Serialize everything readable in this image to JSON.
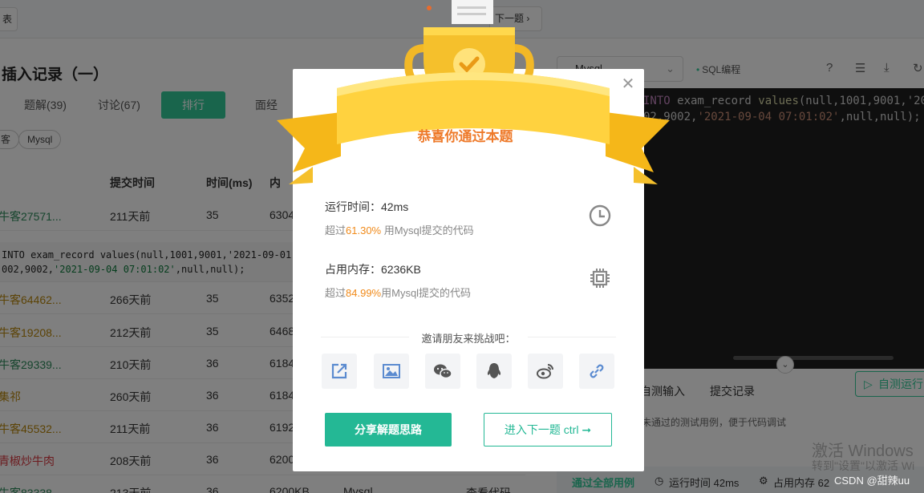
{
  "topbar": {
    "left_btn": "表",
    "next_btn": "下一题 ›"
  },
  "problem": {
    "title": "插入记录（一）"
  },
  "tabs": [
    {
      "label": "题解(39)"
    },
    {
      "label": "讨论(67)"
    },
    {
      "label": "排行"
    },
    {
      "label": "面经"
    }
  ],
  "chips": [
    "客",
    "Mysql"
  ],
  "table": {
    "headers": [
      "提交时间",
      "时间(ms)",
      "内"
    ],
    "rows": [
      {
        "user": "牛客27571...",
        "time": "211天前",
        "ms": "35",
        "mem": "6304"
      },
      {
        "user": "牛客64462...",
        "time": "266天前",
        "ms": "35",
        "mem": "6352"
      },
      {
        "user": "牛客19208...",
        "time": "212天前",
        "ms": "35",
        "mem": "6468"
      },
      {
        "user": "牛客29339...",
        "time": "210天前",
        "ms": "36",
        "mem": "6184"
      },
      {
        "user": "集祁",
        "time": "260天前",
        "ms": "36",
        "mem": "6184"
      },
      {
        "user": "牛客45532...",
        "time": "211天前",
        "ms": "36",
        "mem": "6192"
      },
      {
        "user": "青椒炒牛肉",
        "time": "208天前",
        "ms": "36",
        "mem": "6200"
      },
      {
        "user": "牛客83338",
        "time": "213天前",
        "ms": "36",
        "mem": "6200KB",
        "lang": "Mysql",
        "action": "查看代码"
      }
    ],
    "code_line1": "INTO exam_record values(null,1001,9001,'2021-09-01",
    "code_line2a": "002,9002,",
    "code_line2b": "'2021-09-04 07:01:02'",
    "code_line2c": ",null,null);"
  },
  "right": {
    "lang": "Mysql",
    "tag": "SQL编程",
    "editor_line1_kw": "INTO",
    "editor_line1_rest": " exam_record ",
    "editor_line1_fn": "values",
    "editor_line1_args": "(null,1001,9001,'20",
    "editor_line2": "02,9002,",
    "editor_line2_str": "'2021-09-04 07:01:02'",
    "editor_line2_end": ",null,null);",
    "bottom_tab1": "自测输入",
    "bottom_tab2": "提交记录",
    "selftest": "自测运行",
    "hint": "未通过的测试用例，便于代码调试",
    "status_pass": "通过全部用例",
    "status_time": "运行时间 42ms",
    "status_mem": "占用内存 62"
  },
  "watermark": {
    "line1": "激活 Windows",
    "line2": "转到\"设置\"以激活 Wi",
    "csdn": "CSDN @甜辣uu"
  },
  "modal": {
    "banner": "恭喜你通过本题",
    "runtime_label": "运行时间：42ms",
    "runtime_sub_pre": "超过",
    "runtime_pct": "61.30%",
    "runtime_sub_post": " 用Mysql提交的代码",
    "memory_label": "占用内存：6236KB",
    "memory_sub_pre": "超过",
    "memory_pct": "84.99%",
    "memory_sub_post": "用Mysql提交的代码",
    "invite": "邀请朋友来挑战吧：",
    "share_icons": [
      "share-out-icon",
      "image-icon",
      "wechat-icon",
      "qq-icon",
      "weibo-icon",
      "link-icon"
    ],
    "btn_share": "分享解题思路",
    "btn_next": "进入下一题 ctrl ➞"
  }
}
